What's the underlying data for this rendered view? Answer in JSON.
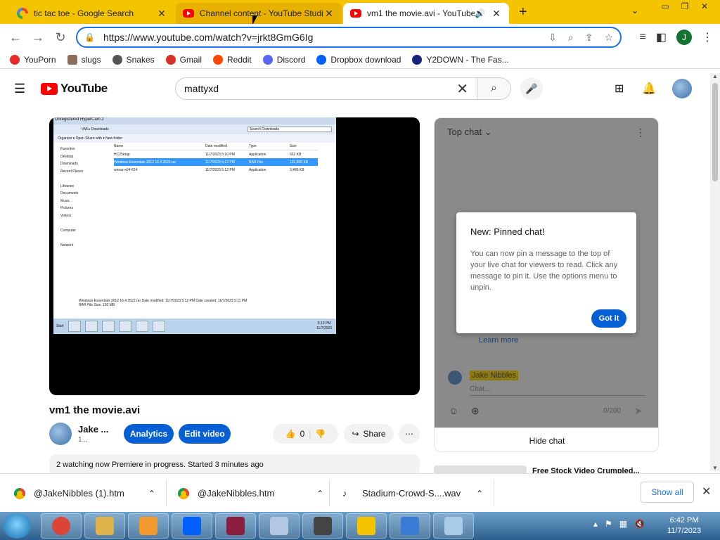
{
  "browser": {
    "tabs": [
      {
        "title": "tic tac toe - Google Search",
        "icon": "google-icon"
      },
      {
        "title": "Channel content - YouTube Studio",
        "icon": "youtube-icon"
      },
      {
        "title": "vm1 the movie.avi - YouTube",
        "icon": "youtube-icon",
        "active": true
      }
    ],
    "url": "https://www.youtube.com/watch?v=jrkt8GmG6Ig",
    "profile_initial": "J",
    "bookmarks": [
      {
        "label": "YouPorn",
        "icon": "youporn-icon",
        "color": "#e52b2b"
      },
      {
        "label": "slugs",
        "icon": "slug-image-icon",
        "color": "#8a6d5a"
      },
      {
        "label": "Snakes",
        "icon": "globe-icon",
        "color": "#555555"
      },
      {
        "label": "Gmail",
        "icon": "gmail-icon",
        "color": "#d93025"
      },
      {
        "label": "Reddit",
        "icon": "reddit-icon",
        "color": "#ff4500"
      },
      {
        "label": "Discord",
        "icon": "discord-icon",
        "color": "#5865f2"
      },
      {
        "label": "Dropbox download",
        "icon": "dropbox-icon",
        "color": "#0061fe"
      },
      {
        "label": "Y2DOWN - The Fas...",
        "icon": "y2down-icon",
        "color": "#1a237e"
      }
    ]
  },
  "youtube": {
    "logo_text": "YouTube",
    "search_value": "mattyxd",
    "video": {
      "title": "vm1 the movie.avi",
      "channel_name": "Jake ...",
      "channel_subs": "1...",
      "analytics_label": "Analytics",
      "edit_label": "Edit video",
      "likes": "0",
      "share_label": "Share",
      "description": "2 watching now  Premiere in progress. Started 3 minutes ago"
    },
    "player_screen": {
      "window_title": "Unregistered HyperCam 2",
      "address": "VMi ▸ Downloads",
      "search_placeholder": "Search Downloads",
      "commands": "Organize ▾    Open    Share with ▾    New folder",
      "nav": [
        "Favorites",
        "Desktop",
        "Downloads",
        "Recent Places",
        "",
        "Libraries",
        "Documents",
        "Music",
        "Pictures",
        "Videos",
        "",
        "Computer",
        "",
        "Network"
      ],
      "columns": [
        "Name",
        "Date modified",
        "Type",
        "Size"
      ],
      "files": [
        {
          "name": "HC25etup",
          "date": "11/7/2023 5:10 PM",
          "type": "Application",
          "size": "652 KB"
        },
        {
          "name": "Windows Essentials 2012 16.4.3522.rar",
          "date": "11/7/2023 5:12 PM",
          "type": "RAR File",
          "size": "131,805 KB",
          "selected": true
        },
        {
          "name": "winrar-x64-624",
          "date": "11/7/2023 5:12 PM",
          "type": "Application",
          "size": "3,486 KB"
        }
      ],
      "status_line1": "Windows Essentials 2012 16.4.3522.rar   Date modified: 11/7/2023 5:12 PM          Date created: 11/7/2023 5:11 PM",
      "status_line2": "RAR File                                          Size: 130 MB",
      "clock_time": "5:13 PM",
      "clock_date": "11/7/2023",
      "start_label": "Start"
    },
    "chat": {
      "header": "Top chat",
      "popup_title": "New: Pinned chat!",
      "popup_text": "You can now pin a message to the top of your live chat for viewers to read. Click any message to pin it. Use the options menu to unpin.",
      "popup_button": "Got it",
      "learn_more": "Learn more",
      "user": "Jake Nibbles",
      "input_placeholder": "Chat...",
      "char_count": "0/200",
      "hide_label": "Hide chat"
    },
    "recommended_title": "Free Stock Video Crumpled..."
  },
  "downloads": {
    "items": [
      {
        "name": "@JakeNibbles (1).htm",
        "icon": "chrome-icon"
      },
      {
        "name": "@JakeNibbles.htm",
        "icon": "chrome-icon"
      },
      {
        "name": "Stadium-Crowd-S....wav",
        "icon": "audio-file-icon"
      }
    ],
    "show_all": "Show all"
  },
  "taskbar": {
    "apps": [
      {
        "name": "chrome",
        "color": "#db4437"
      },
      {
        "name": "file-explorer",
        "color": "#e0b24a"
      },
      {
        "name": "media-player",
        "color": "#f29a2e"
      },
      {
        "name": "dropbox",
        "color": "#0061fe"
      },
      {
        "name": "winrar",
        "color": "#8b1e3f"
      },
      {
        "name": "mspaint",
        "color": "#b3c7e0"
      },
      {
        "name": "hypercam",
        "color": "#444444"
      },
      {
        "name": "sketchbook",
        "color": "#f5c400"
      },
      {
        "name": "photo-viewer",
        "color": "#3a7bd5"
      },
      {
        "name": "notepad",
        "color": "#a9cbe8"
      }
    ],
    "time": "6:42 PM",
    "date": "11/7/2023"
  }
}
